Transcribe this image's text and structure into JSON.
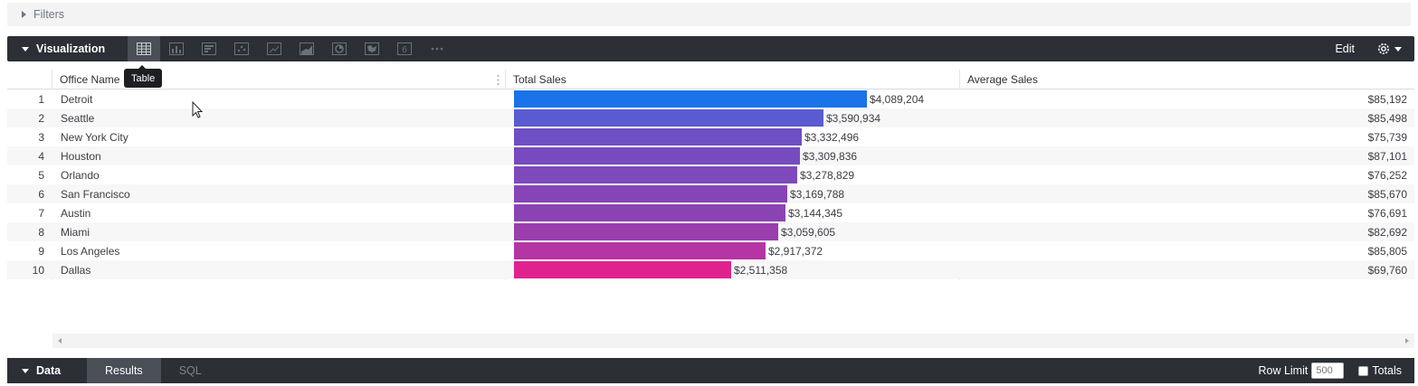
{
  "filters": {
    "label": "Filters"
  },
  "visualization": {
    "toggle_label": "Visualization",
    "edit_label": "Edit",
    "tooltip": "Table",
    "icons": [
      {
        "name": "table-icon",
        "active": true
      },
      {
        "name": "column-chart-icon",
        "active": false
      },
      {
        "name": "bar-chart-icon",
        "active": false
      },
      {
        "name": "scatter-icon",
        "active": false
      },
      {
        "name": "line-chart-icon",
        "active": false
      },
      {
        "name": "area-chart-icon",
        "active": false
      },
      {
        "name": "pie-chart-icon",
        "active": false
      },
      {
        "name": "map-icon",
        "active": false
      },
      {
        "name": "single-value-icon",
        "active": false,
        "text": "6"
      },
      {
        "name": "more-icon",
        "active": false
      }
    ]
  },
  "table": {
    "columns": [
      "Office Name",
      "Total Sales",
      "Average Sales"
    ],
    "bar_max": 4089204,
    "rows": [
      {
        "idx": "1",
        "office": "Detroit",
        "total_value": 4089204,
        "total": "$4,089,204",
        "avg": "$85,192",
        "color": "#1a73e8"
      },
      {
        "idx": "2",
        "office": "Seattle",
        "total_value": 3590934,
        "total": "$3,590,934",
        "avg": "$85,498",
        "color": "#5a5bd0"
      },
      {
        "idx": "3",
        "office": "New York City",
        "total_value": 3332496,
        "total": "$3,332,496",
        "avg": "$75,739",
        "color": "#6f4fc4"
      },
      {
        "idx": "4",
        "office": "Houston",
        "total_value": 3309836,
        "total": "$3,309,836",
        "avg": "$87,101",
        "color": "#774bbf"
      },
      {
        "idx": "5",
        "office": "Orlando",
        "total_value": 3278829,
        "total": "$3,278,829",
        "avg": "$76,252",
        "color": "#7d49bb"
      },
      {
        "idx": "6",
        "office": "San Francisco",
        "total_value": 3169788,
        "total": "$3,169,788",
        "avg": "$85,670",
        "color": "#8645b7"
      },
      {
        "idx": "7",
        "office": "Austin",
        "total_value": 3144345,
        "total": "$3,144,345",
        "avg": "$76,691",
        "color": "#8b43b4"
      },
      {
        "idx": "8",
        "office": "Miami",
        "total_value": 3059605,
        "total": "$3,059,605",
        "avg": "$82,692",
        "color": "#9a3eae"
      },
      {
        "idx": "9",
        "office": "Los Angeles",
        "total_value": 2917372,
        "total": "$2,917,372",
        "avg": "$85,805",
        "color": "#b535a5"
      },
      {
        "idx": "10",
        "office": "Dallas",
        "total_value": 2511358,
        "total": "$2,511,358",
        "avg": "$69,760",
        "color": "#e0228f"
      }
    ]
  },
  "data_bar": {
    "toggle_label": "Data",
    "tabs": [
      {
        "label": "Results",
        "active": true
      },
      {
        "label": "SQL",
        "active": false
      }
    ],
    "row_limit_label": "Row Limit",
    "row_limit_value": "500",
    "totals_label": "Totals"
  }
}
